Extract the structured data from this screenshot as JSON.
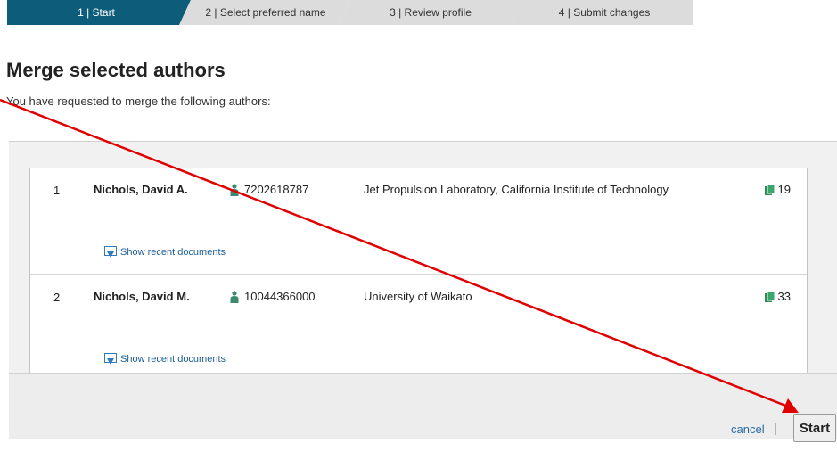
{
  "steps": [
    {
      "label": "1 | Start"
    },
    {
      "label": "2 | Select preferred name"
    },
    {
      "label": "3 | Review profile"
    },
    {
      "label": "4 | Submit changes"
    }
  ],
  "page": {
    "title": "Merge selected authors",
    "intro": "You have requested to merge the following authors:"
  },
  "authors": [
    {
      "num": "1",
      "name": "Nichols, David A.",
      "author_id": "7202618787",
      "affiliation": "Jet Propulsion Laboratory, California Institute of Technology",
      "docs": "19",
      "recent_label": "Show recent documents"
    },
    {
      "num": "2",
      "name": "Nichols, David M.",
      "author_id": "10044366000",
      "affiliation": "University of Waikato",
      "docs": "33",
      "recent_label": "Show recent documents"
    }
  ],
  "actions": {
    "cancel": "cancel",
    "separator": "|",
    "start": "Start"
  },
  "colors": {
    "active_step": "#0d5c7a",
    "inactive_step": "#dcdcdc",
    "author_icon": "#3c8a6b",
    "docs_icon": "#2e8b57",
    "link": "#1f5d94",
    "annotation_arrow": "#e00000"
  },
  "icons": {
    "author": "person-icon",
    "documents": "documents-icon",
    "recent": "download-box-icon"
  }
}
